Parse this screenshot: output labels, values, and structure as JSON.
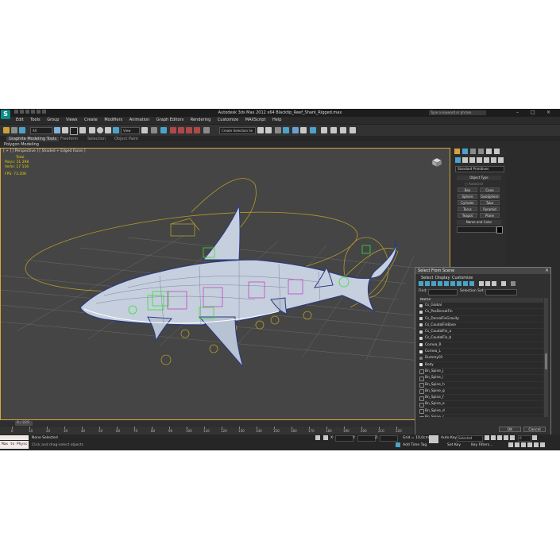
{
  "titlebar": {
    "title": "Autodesk 3ds Max 2012 x64    Blacktip_Reef_Shark_Rigged.max",
    "search_placeholder": "Type a keyword or phrase"
  },
  "menu": [
    "Edit",
    "Tools",
    "Group",
    "Views",
    "Create",
    "Modifiers",
    "Animation",
    "Graph Editors",
    "Rendering",
    "Customize",
    "MAXScript",
    "Help"
  ],
  "toolbar": {
    "selection_filter": "All",
    "ref_coord": "View",
    "named_selection": "Create Selection Se"
  },
  "ribbon": {
    "tabs": [
      "Graphite Modeling Tools",
      "Freeform",
      "Selection",
      "Object Paint"
    ],
    "sub": "Polygon Modeling"
  },
  "viewport": {
    "label": "[ + ] [ Perspective ] [ Shaded + Edged Faces ]",
    "stats_header": "Total",
    "polys_label": "Polys:",
    "polys_value": "31 298",
    "verts_label": "Verts:",
    "verts_value": "17 116",
    "fps_label": "FPS:",
    "fps_value": "73.208"
  },
  "command_panel": {
    "category": "Standard Primitives",
    "object_type_title": "Object Type",
    "autogrid": "AutoGrid",
    "buttons": [
      "Box",
      "Cone",
      "Sphere",
      "GeoSphere",
      "Cylinder",
      "Tube",
      "Torus",
      "Pyramid",
      "Teapot",
      "Plane"
    ],
    "name_color_title": "Name and Color",
    "color": "#000000"
  },
  "select_from_scene": {
    "title": "Select From Scene",
    "menus": [
      "Select",
      "Display",
      "Customize"
    ],
    "find_label": "Find:",
    "selection_set_label": "Selection Set:",
    "column_header": "Name",
    "items": [
      {
        "name": "Cs_Global",
        "kind": "ctrl"
      },
      {
        "name": "Cs_PosDorsalFin",
        "kind": "ctrl"
      },
      {
        "name": "Cs_DorsalFinGravity",
        "kind": "ctrl"
      },
      {
        "name": "Cs_CaudalFinBase",
        "kind": "ctrl"
      },
      {
        "name": "Cs_CaudalFin_a",
        "kind": "ctrl"
      },
      {
        "name": "Cs_CaudalFin_b",
        "kind": "ctrl"
      },
      {
        "name": "Cornea_R",
        "kind": "mesh"
      },
      {
        "name": "Cornea_L",
        "kind": "mesh"
      },
      {
        "name": "Dummy01",
        "kind": "dummy"
      },
      {
        "name": "Body",
        "kind": "mesh"
      },
      {
        "name": "Bn_Spine_j",
        "kind": "bone"
      },
      {
        "name": "Bn_Spine_i",
        "kind": "bone"
      },
      {
        "name": "Bn_Spine_h",
        "kind": "bone"
      },
      {
        "name": "Bn_Spine_g",
        "kind": "bone"
      },
      {
        "name": "Bn_Spine_f",
        "kind": "bone"
      },
      {
        "name": "Bn_Spine_e",
        "kind": "bone"
      },
      {
        "name": "Bn_Spine_d",
        "kind": "bone"
      },
      {
        "name": "Bn_Spine_c",
        "kind": "bone"
      },
      {
        "name": "Bn_Spine_b",
        "kind": "bone"
      },
      {
        "name": "Bn_Spine_a",
        "kind": "bone"
      }
    ],
    "ok": "OK",
    "cancel": "Cancel"
  },
  "timeline": {
    "frame": "0 / 225",
    "ticks": [
      "0",
      "10",
      "20",
      "30",
      "40",
      "50",
      "60",
      "70",
      "80",
      "90",
      "100",
      "110",
      "120",
      "130",
      "140",
      "150",
      "160",
      "170",
      "180",
      "190",
      "200",
      "210",
      "220"
    ]
  },
  "status": {
    "maxscript": "Max to Physc",
    "selected": "None Selected",
    "prompt": "Click and drag-select objects",
    "x_label": "X:",
    "y_label": "Y:",
    "z_label": "Z:",
    "grid": "Grid = 10,0cm",
    "add_time_tag": "Add Time Tag",
    "auto_key": "Auto Key",
    "set_key": "Set Key",
    "selected_dropdown": "Selected",
    "key_filters": "Key Filters...",
    "frame_value": "0"
  },
  "colors": {
    "accent": "#d6a83e",
    "viewport_bg": "#454545",
    "stats": "#e0d000",
    "shark_dark": "#3a4d7a",
    "shark_light": "#dde4ee",
    "wire_green": "#33e033",
    "wire_magenta": "#c033c0",
    "spline_yellow": "#b39a2a"
  }
}
